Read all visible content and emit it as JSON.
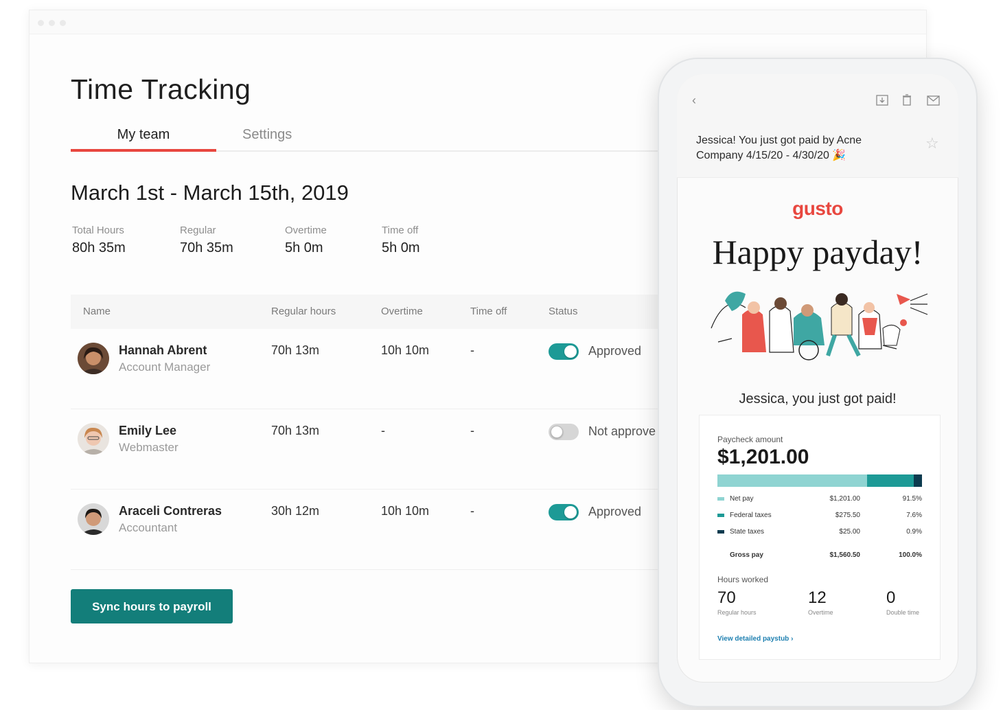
{
  "page": {
    "title": "Time Tracking",
    "tabs": [
      "My team",
      "Settings"
    ],
    "period": "March 1st - March 15th, 2019"
  },
  "stats": [
    {
      "label": "Total Hours",
      "value": "80h 35m"
    },
    {
      "label": "Regular",
      "value": "70h 35m"
    },
    {
      "label": "Overtime",
      "value": "5h 0m"
    },
    {
      "label": "Time off",
      "value": "5h 0m"
    }
  ],
  "table": {
    "headers": [
      "Name",
      "Regular hours",
      "Overtime",
      "Time off",
      "Status"
    ],
    "rows": [
      {
        "name": "Hannah Abrent",
        "role": "Account Manager",
        "regular": "70h 13m",
        "overtime": "10h 10m",
        "timeoff": "-",
        "approved": true,
        "status": "Approved"
      },
      {
        "name": "Emily Lee",
        "role": "Webmaster",
        "regular": "70h 13m",
        "overtime": "-",
        "timeoff": "-",
        "approved": false,
        "status": "Not approve"
      },
      {
        "name": "Araceli Contreras",
        "role": "Accountant",
        "regular": "30h 12m",
        "overtime": "10h 10m",
        "timeoff": "-",
        "approved": true,
        "status": "Approved"
      }
    ]
  },
  "sync_button": "Sync hours to payroll",
  "phone": {
    "subject": "Jessica! You just got paid by Acne Company 4/15/20 - 4/30/20 🎉",
    "brand": "gusto",
    "headline": "Happy payday!",
    "paid_line": "Jessica, you just got paid!",
    "paycheck_label": "Paycheck amount",
    "paycheck_amount": "$1,201.00",
    "breakdown": [
      {
        "name": "Net pay",
        "amount": "$1,201.00",
        "pct": "91.5%",
        "color": "#8fd4d2",
        "share": 0.73
      },
      {
        "name": "Federal taxes",
        "amount": "$275.50",
        "pct": "7.6%",
        "color": "#1d9a96",
        "share": 0.23
      },
      {
        "name": "State taxes",
        "amount": "$25.00",
        "pct": "0.9%",
        "color": "#0d3b4f",
        "share": 0.04
      }
    ],
    "gross": {
      "name": "Gross pay",
      "amount": "$1,560.50",
      "pct": "100.0%"
    },
    "hours_label": "Hours worked",
    "hours": [
      {
        "value": "70",
        "label": "Regular hours"
      },
      {
        "value": "12",
        "label": "Overtime"
      },
      {
        "value": "0",
        "label": "Double time"
      }
    ],
    "link": "View detailed paystub ›",
    "icons": [
      "back-icon",
      "download-icon",
      "trash-icon",
      "mail-icon",
      "star-icon"
    ]
  },
  "colors": {
    "accent": "#e8473f",
    "teal": "#1d9a96",
    "button": "#137e7a"
  }
}
